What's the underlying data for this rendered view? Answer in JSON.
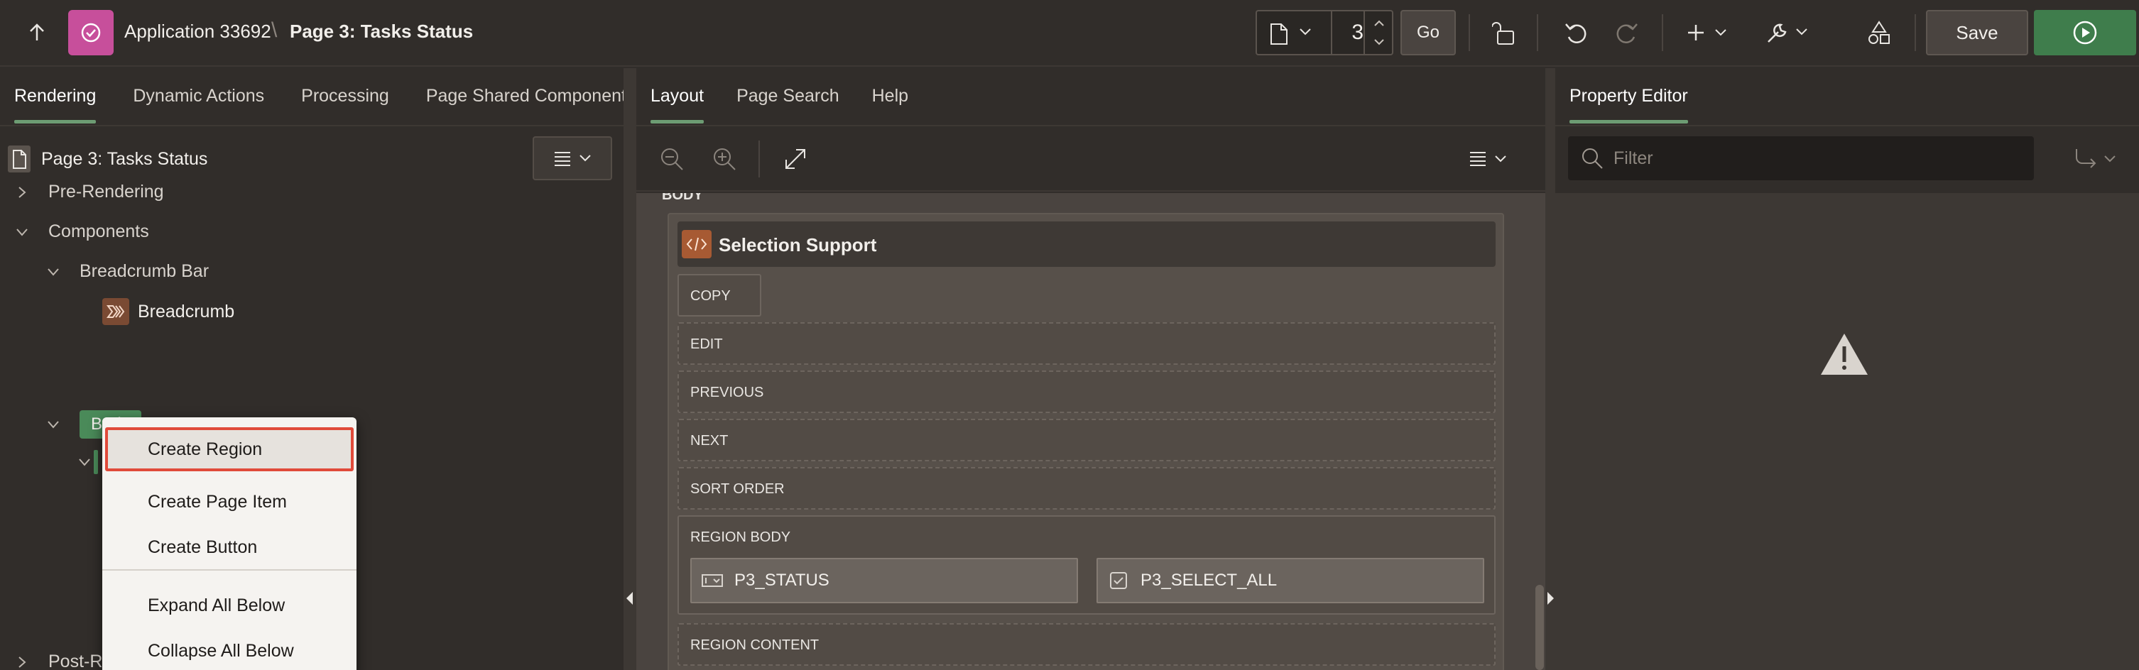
{
  "header": {
    "app_title": "Application 33692",
    "separator": "\\",
    "page_title": "Page 3: Tasks Status",
    "page_number": "3",
    "go_label": "Go",
    "save_label": "Save"
  },
  "left_panel": {
    "tabs": [
      {
        "label": "Rendering",
        "active": true
      },
      {
        "label": "Dynamic Actions",
        "active": false
      },
      {
        "label": "Processing",
        "active": false
      },
      {
        "label": "Page Shared Components",
        "active": false
      }
    ],
    "tree": {
      "root": "Page 3: Tasks Status",
      "pre_rendering": "Pre-Rendering",
      "components": "Components",
      "breadcrumb_bar": "Breadcrumb Bar",
      "breadcrumb": "Breadcrumb",
      "body": "Body",
      "post_rendering": "Post-Rendering"
    }
  },
  "context_menu": {
    "items": [
      "Create Region",
      "Create Page Item",
      "Create Button"
    ],
    "items2": [
      "Expand All Below",
      "Collapse All Below"
    ]
  },
  "center_panel": {
    "tabs": [
      {
        "label": "Layout",
        "active": true
      },
      {
        "label": "Page Search",
        "active": false
      },
      {
        "label": "Help",
        "active": false
      }
    ],
    "body_label": "BODY",
    "region_title": "Selection Support",
    "slots": [
      "COPY",
      "EDIT",
      "PREVIOUS",
      "NEXT",
      "SORT ORDER",
      "REGION BODY",
      "REGION CONTENT"
    ],
    "items": [
      "P3_STATUS",
      "P3_SELECT_ALL"
    ]
  },
  "right_panel": {
    "tab": "Property Editor",
    "filter_placeholder": "Filter"
  },
  "colors": {
    "app_badge": "#c74f9b",
    "run_button": "#3f7d4c",
    "active_tab_underline": "#6d9c73",
    "focus_outline": "#e04a3a"
  }
}
